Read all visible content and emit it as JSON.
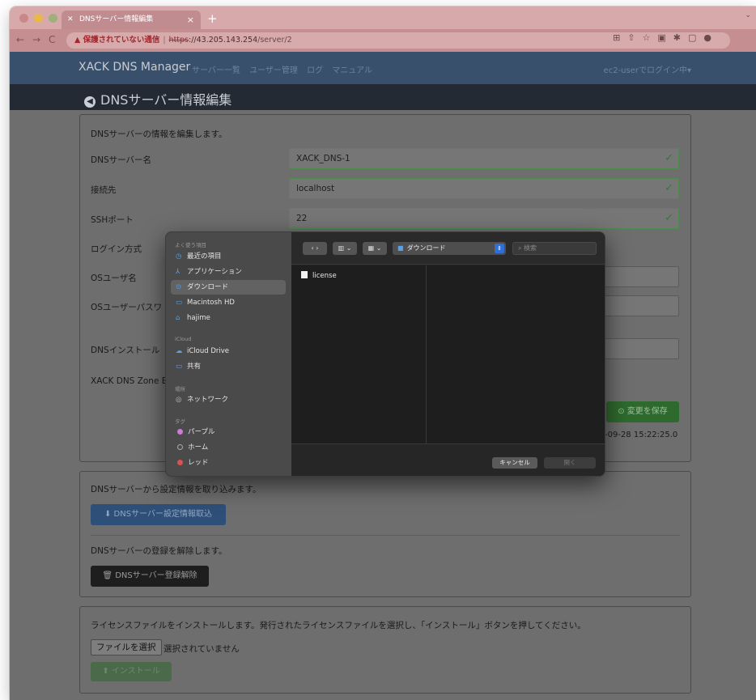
{
  "browser": {
    "tab_title": "DNSサーバー情報編集",
    "tab_close": "×",
    "new_tab": "+",
    "nav_back": "←",
    "nav_forward": "→",
    "nav_reload": "C",
    "security_warning": "▲ 保護されていない通信",
    "url_scheme": "https",
    "url_rest": "://43.205.143.254",
    "url_path": "/server/2"
  },
  "navbar": {
    "brand": "XACK DNS Manager",
    "links": [
      "サーバー一覧",
      "ユーザー管理",
      "ログ",
      "マニュアル"
    ],
    "login_status": "ec2-userでログイン中▾"
  },
  "page_title": "DNSサーバー情報編集",
  "form": {
    "intro": "DNSサーバーの情報を編集します。",
    "labels": {
      "server_name": "DNSサーバー名",
      "host": "接続先",
      "ssh_port": "SSHポート",
      "login_method": "ログイン方式",
      "os_user": "OSユーザ名",
      "os_password": "OSユーザーパスワ",
      "install_dir": "DNSインストール",
      "zone_editor": "XACK DNS Zone E"
    },
    "values": {
      "server_name": "XACK_DNS-1",
      "host": "localhost",
      "ssh_port": "22"
    },
    "save_label": "⊙ 変更を保存",
    "timestamp": "-09-28 15:22:25.0"
  },
  "import_section": {
    "text": "DNSサーバーから設定情報を取り込みます。",
    "button": "⬇ DNSサーバー設定情報取込",
    "unregister_text": "DNSサーバーの登録を解除します。",
    "unregister_button": "🗑 DNSサーバー登録解除"
  },
  "license_section": {
    "text": "ライセンスファイルをインストールします。発行されたライセンスファイルを選択し、「インストール」ボタンを押してください。",
    "choose_file": "ファイルを選択",
    "no_file": "選択されていません",
    "install_button": "⬆ インストール"
  },
  "dialog": {
    "favorites_header": "よく使う項目",
    "favorites": [
      {
        "label": "最近の項目",
        "icon": "◷"
      },
      {
        "label": "アプリケーション",
        "icon": "⅄"
      },
      {
        "label": "ダウンロード",
        "icon": "⊙"
      },
      {
        "label": "Macintosh HD",
        "icon": "▭"
      },
      {
        "label": "hajime",
        "icon": "⌂"
      }
    ],
    "icloud_header": "iCloud",
    "icloud": [
      {
        "label": "iCloud Drive",
        "icon": "☁"
      },
      {
        "label": "共有",
        "icon": "▭"
      }
    ],
    "places_header": "場所",
    "places": [
      {
        "label": "ネットワーク",
        "icon": "◎"
      }
    ],
    "tags_header": "タグ",
    "tags": [
      {
        "label": "パープル",
        "color": "#d07ad8"
      },
      {
        "label": "ホーム",
        "color": "transparent"
      },
      {
        "label": "レッド",
        "color": "#e05050"
      }
    ],
    "location": "ダウンロード",
    "search_placeholder": "検索",
    "files": [
      "license"
    ],
    "cancel": "キャンセル",
    "open": "開く"
  }
}
